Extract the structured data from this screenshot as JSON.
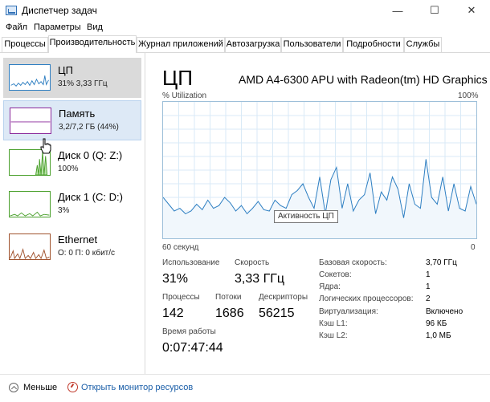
{
  "window": {
    "title": "Диспетчер задач",
    "controls": {
      "minimize": "—",
      "maximize": "☐",
      "close": "✕"
    }
  },
  "menu": [
    "Файл",
    "Параметры",
    "Вид"
  ],
  "tabs": [
    "Процессы",
    "Производительность",
    "Журнал приложений",
    "Автозагрузка",
    "Пользователи",
    "Подробности",
    "Службы"
  ],
  "active_tab": "Производительность",
  "sidebar": {
    "items": [
      {
        "title": "ЦП",
        "sub": "31% 3,33 ГГц",
        "color": "#2e7fc2"
      },
      {
        "title": "Память",
        "sub": "3,2/7,2 ГБ (44%)",
        "color": "#8b2a9b"
      },
      {
        "title": "Диск 0 (Q: Z:)",
        "sub": "100%",
        "color": "#4aa02c"
      },
      {
        "title": "Диск 1 (C: D:)",
        "sub": "3%",
        "color": "#4aa02c"
      },
      {
        "title": "Ethernet",
        "sub": "О: 0 П: 0 кбит/с",
        "color": "#a0522d"
      }
    ]
  },
  "detail": {
    "heading": "ЦП",
    "model": "AMD A4-6300 APU with Radeon(tm) HD Graphics",
    "util_label": "% Utilization",
    "util_max": "100%",
    "graph_left": "60 секунд",
    "graph_right": "0",
    "tooltip": "Активность ЦП",
    "stats": {
      "usage_label": "Использование",
      "usage_value": "31%",
      "speed_label": "Скорость",
      "speed_value": "3,33 ГГц",
      "procs_label": "Процессы",
      "procs_value": "142",
      "threads_label": "Потоки",
      "threads_value": "1686",
      "handles_label": "Дескрипторы",
      "handles_value": "56215",
      "uptime_label": "Время работы",
      "uptime_value": "0:07:47:44"
    },
    "specs": [
      {
        "label": "Базовая скорость:",
        "value": "3,70 ГГц"
      },
      {
        "label": "Сокетов:",
        "value": "1"
      },
      {
        "label": "Ядра:",
        "value": "1"
      },
      {
        "label": "Логических процессоров:",
        "value": "2"
      },
      {
        "label": "Виртуализация:",
        "value": "Включено"
      },
      {
        "label": "Кэш L1:",
        "value": "96 КБ"
      },
      {
        "label": "Кэш L2:",
        "value": "1,0 МБ"
      }
    ]
  },
  "footer": {
    "less": "Меньше",
    "open_monitor": "Открыть монитор ресурсов"
  },
  "chart_data": {
    "type": "line",
    "ylim": [
      0,
      100
    ],
    "values": [
      30,
      25,
      20,
      22,
      18,
      20,
      25,
      21,
      28,
      22,
      24,
      30,
      26,
      20,
      24,
      18,
      22,
      27,
      21,
      20,
      28,
      24,
      22,
      32,
      35,
      40,
      30,
      22,
      45,
      18,
      43,
      52,
      22,
      40,
      20,
      28,
      32,
      48,
      18,
      34,
      28,
      45,
      36,
      15,
      40,
      25,
      22,
      58,
      30,
      25,
      45,
      20,
      40,
      22,
      20,
      38,
      25
    ]
  },
  "colors": {
    "cpu": "#2e7fc2",
    "accent": "#1a5ea8"
  }
}
